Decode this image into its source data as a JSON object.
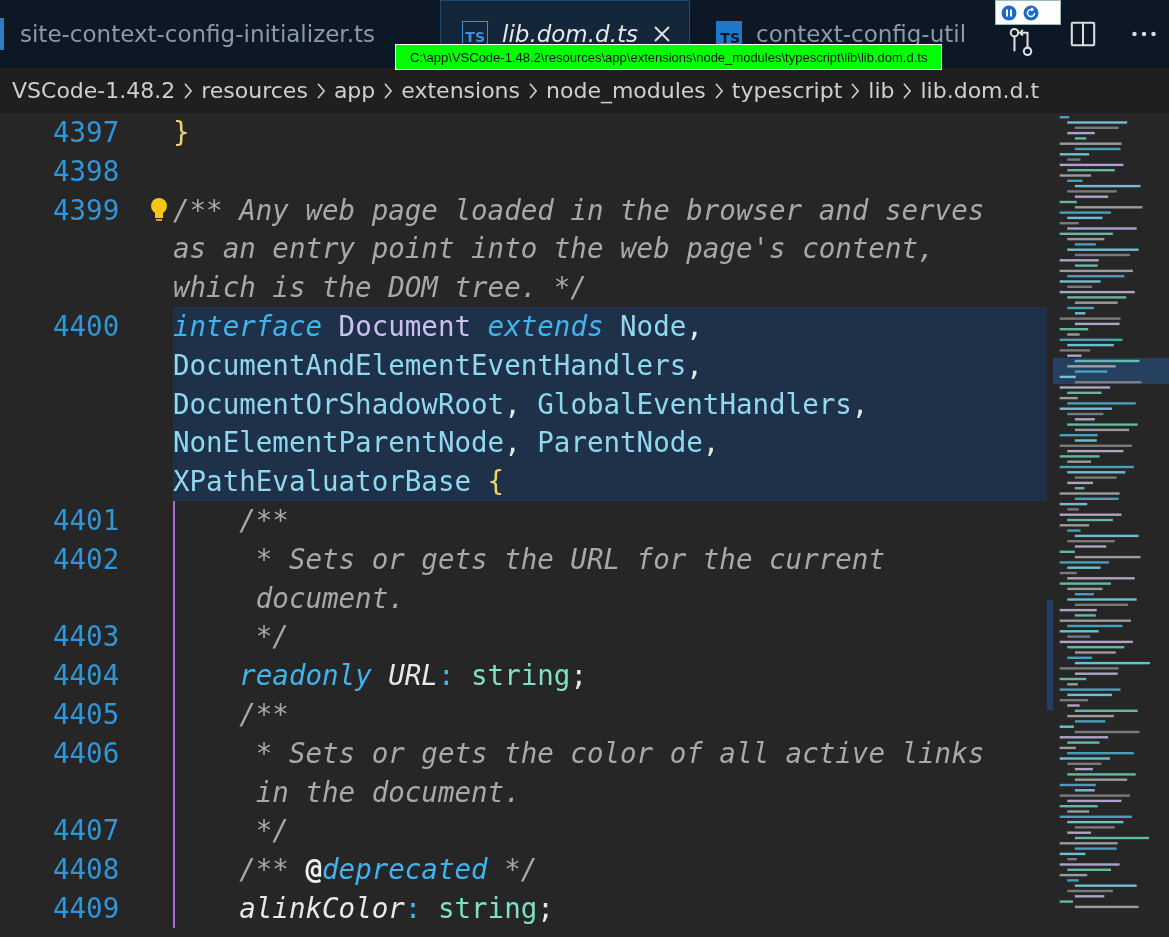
{
  "tabs": [
    {
      "label": "site-context-config-initializer.ts",
      "selected": false,
      "italic": false,
      "closable": false
    },
    {
      "label": "lib.dom.d.ts",
      "icon": "TS",
      "selected": true,
      "italic": true,
      "closable": true
    },
    {
      "label": "context-config-util",
      "icon": "TS",
      "selected": false,
      "italic": false,
      "closable": false
    }
  ],
  "breadcrumbs": [
    "VSCode-1.48.2",
    "resources",
    "app",
    "extensions",
    "node_modules",
    "typescript",
    "lib",
    "lib.dom.d.t"
  ],
  "tooltip": "C:\\app\\VSCode-1.48.2\\resources\\app\\extensions\\node_modules\\typescript\\lib\\lib.dom.d.ts",
  "editor": {
    "lines": [
      {
        "number": "4397",
        "current": false,
        "rows": [
          {
            "tokens": [
              {
                "text": "}",
                "kind": "brace"
              }
            ]
          }
        ]
      },
      {
        "number": "4398",
        "current": false,
        "rows": [
          {
            "tokens": []
          }
        ]
      },
      {
        "number": "4399",
        "current": false,
        "lightbulb": true,
        "rows": [
          {
            "tokens": [
              {
                "text": "/** Any web page loaded in the browser and serves",
                "kind": "comment"
              }
            ]
          },
          {
            "tokens": [
              {
                "text": "as an entry point into the web page's content,",
                "kind": "comment"
              }
            ]
          },
          {
            "tokens": [
              {
                "text": "which is the DOM tree. */",
                "kind": "comment"
              }
            ]
          }
        ]
      },
      {
        "number": "4400",
        "current": true,
        "rows": [
          {
            "tokens": [
              {
                "text": "interface ",
                "kind": "keyword"
              },
              {
                "text": "Document ",
                "kind": "name"
              },
              {
                "text": "extends ",
                "kind": "keyword"
              },
              {
                "text": "Node",
                "kind": "type"
              },
              {
                "text": ",",
                "kind": "plain"
              }
            ]
          },
          {
            "tokens": [
              {
                "text": "DocumentAndElementEventHandlers",
                "kind": "type"
              },
              {
                "text": ",",
                "kind": "plain"
              }
            ]
          },
          {
            "tokens": [
              {
                "text": "DocumentOrShadowRoot",
                "kind": "type"
              },
              {
                "text": ", ",
                "kind": "plain"
              },
              {
                "text": "GlobalEventHandlers",
                "kind": "type"
              },
              {
                "text": ",",
                "kind": "plain"
              }
            ]
          },
          {
            "tokens": [
              {
                "text": "NonElementParentNode",
                "kind": "type"
              },
              {
                "text": ", ",
                "kind": "plain"
              },
              {
                "text": "ParentNode",
                "kind": "type"
              },
              {
                "text": ",",
                "kind": "plain"
              }
            ]
          },
          {
            "tokens": [
              {
                "text": "XPathEvaluatorBase ",
                "kind": "type"
              },
              {
                "text": "{",
                "kind": "brace"
              }
            ]
          }
        ],
        "children": [
          {
            "number": "4401",
            "current": false,
            "rows": [
              {
                "tokens": [
                  {
                    "text": "/**",
                    "kind": "comment"
                  }
                ]
              }
            ]
          },
          {
            "number": "4402",
            "current": false,
            "rows": [
              {
                "tokens": [
                  {
                    "text": " * Sets or gets the URL for the current",
                    "kind": "comment"
                  }
                ]
              },
              {
                "tokens": [
                  {
                    "text": "document.",
                    "kind": "comment"
                  }
                ]
              }
            ]
          },
          {
            "number": "4403",
            "current": false,
            "rows": [
              {
                "tokens": [
                  {
                    "text": " */",
                    "kind": "comment"
                  }
                ]
              }
            ]
          },
          {
            "number": "4404",
            "current": false,
            "rows": [
              {
                "tokens": [
                  {
                    "text": "readonly ",
                    "kind": "keyword"
                  },
                  {
                    "text": "URL",
                    "kind": "prop"
                  },
                  {
                    "text": ": ",
                    "kind": "colon"
                  },
                  {
                    "text": "string",
                    "kind": "type2"
                  },
                  {
                    "text": ";",
                    "kind": "plain"
                  }
                ]
              }
            ]
          },
          {
            "number": "4405",
            "current": false,
            "rows": [
              {
                "tokens": [
                  {
                    "text": "/**",
                    "kind": "comment"
                  }
                ]
              }
            ]
          },
          {
            "number": "4406",
            "current": false,
            "rows": [
              {
                "tokens": [
                  {
                    "text": " * Sets or gets the color of all active links",
                    "kind": "comment"
                  }
                ]
              },
              {
                "tokens": [
                  {
                    "text": "in the document.",
                    "kind": "comment"
                  }
                ]
              }
            ]
          },
          {
            "number": "4407",
            "current": false,
            "rows": [
              {
                "tokens": [
                  {
                    "text": " */",
                    "kind": "comment"
                  }
                ]
              }
            ]
          },
          {
            "number": "4408",
            "current": false,
            "rows": [
              {
                "tokens": [
                  {
                    "text": "/** ",
                    "kind": "comment"
                  },
                  {
                    "text": "@",
                    "kind": "at"
                  },
                  {
                    "text": "deprecated",
                    "kind": "keyword"
                  },
                  {
                    "text": " */",
                    "kind": "comment"
                  }
                ]
              }
            ]
          },
          {
            "number": "4409",
            "current": false,
            "rows": [
              {
                "tokens": [
                  {
                    "text": "alinkColor",
                    "kind": "prop"
                  },
                  {
                    "text": ": ",
                    "kind": "colon"
                  },
                  {
                    "text": "string",
                    "kind": "type2"
                  },
                  {
                    "text": ";",
                    "kind": "plain"
                  }
                ]
              }
            ]
          }
        ]
      }
    ]
  }
}
